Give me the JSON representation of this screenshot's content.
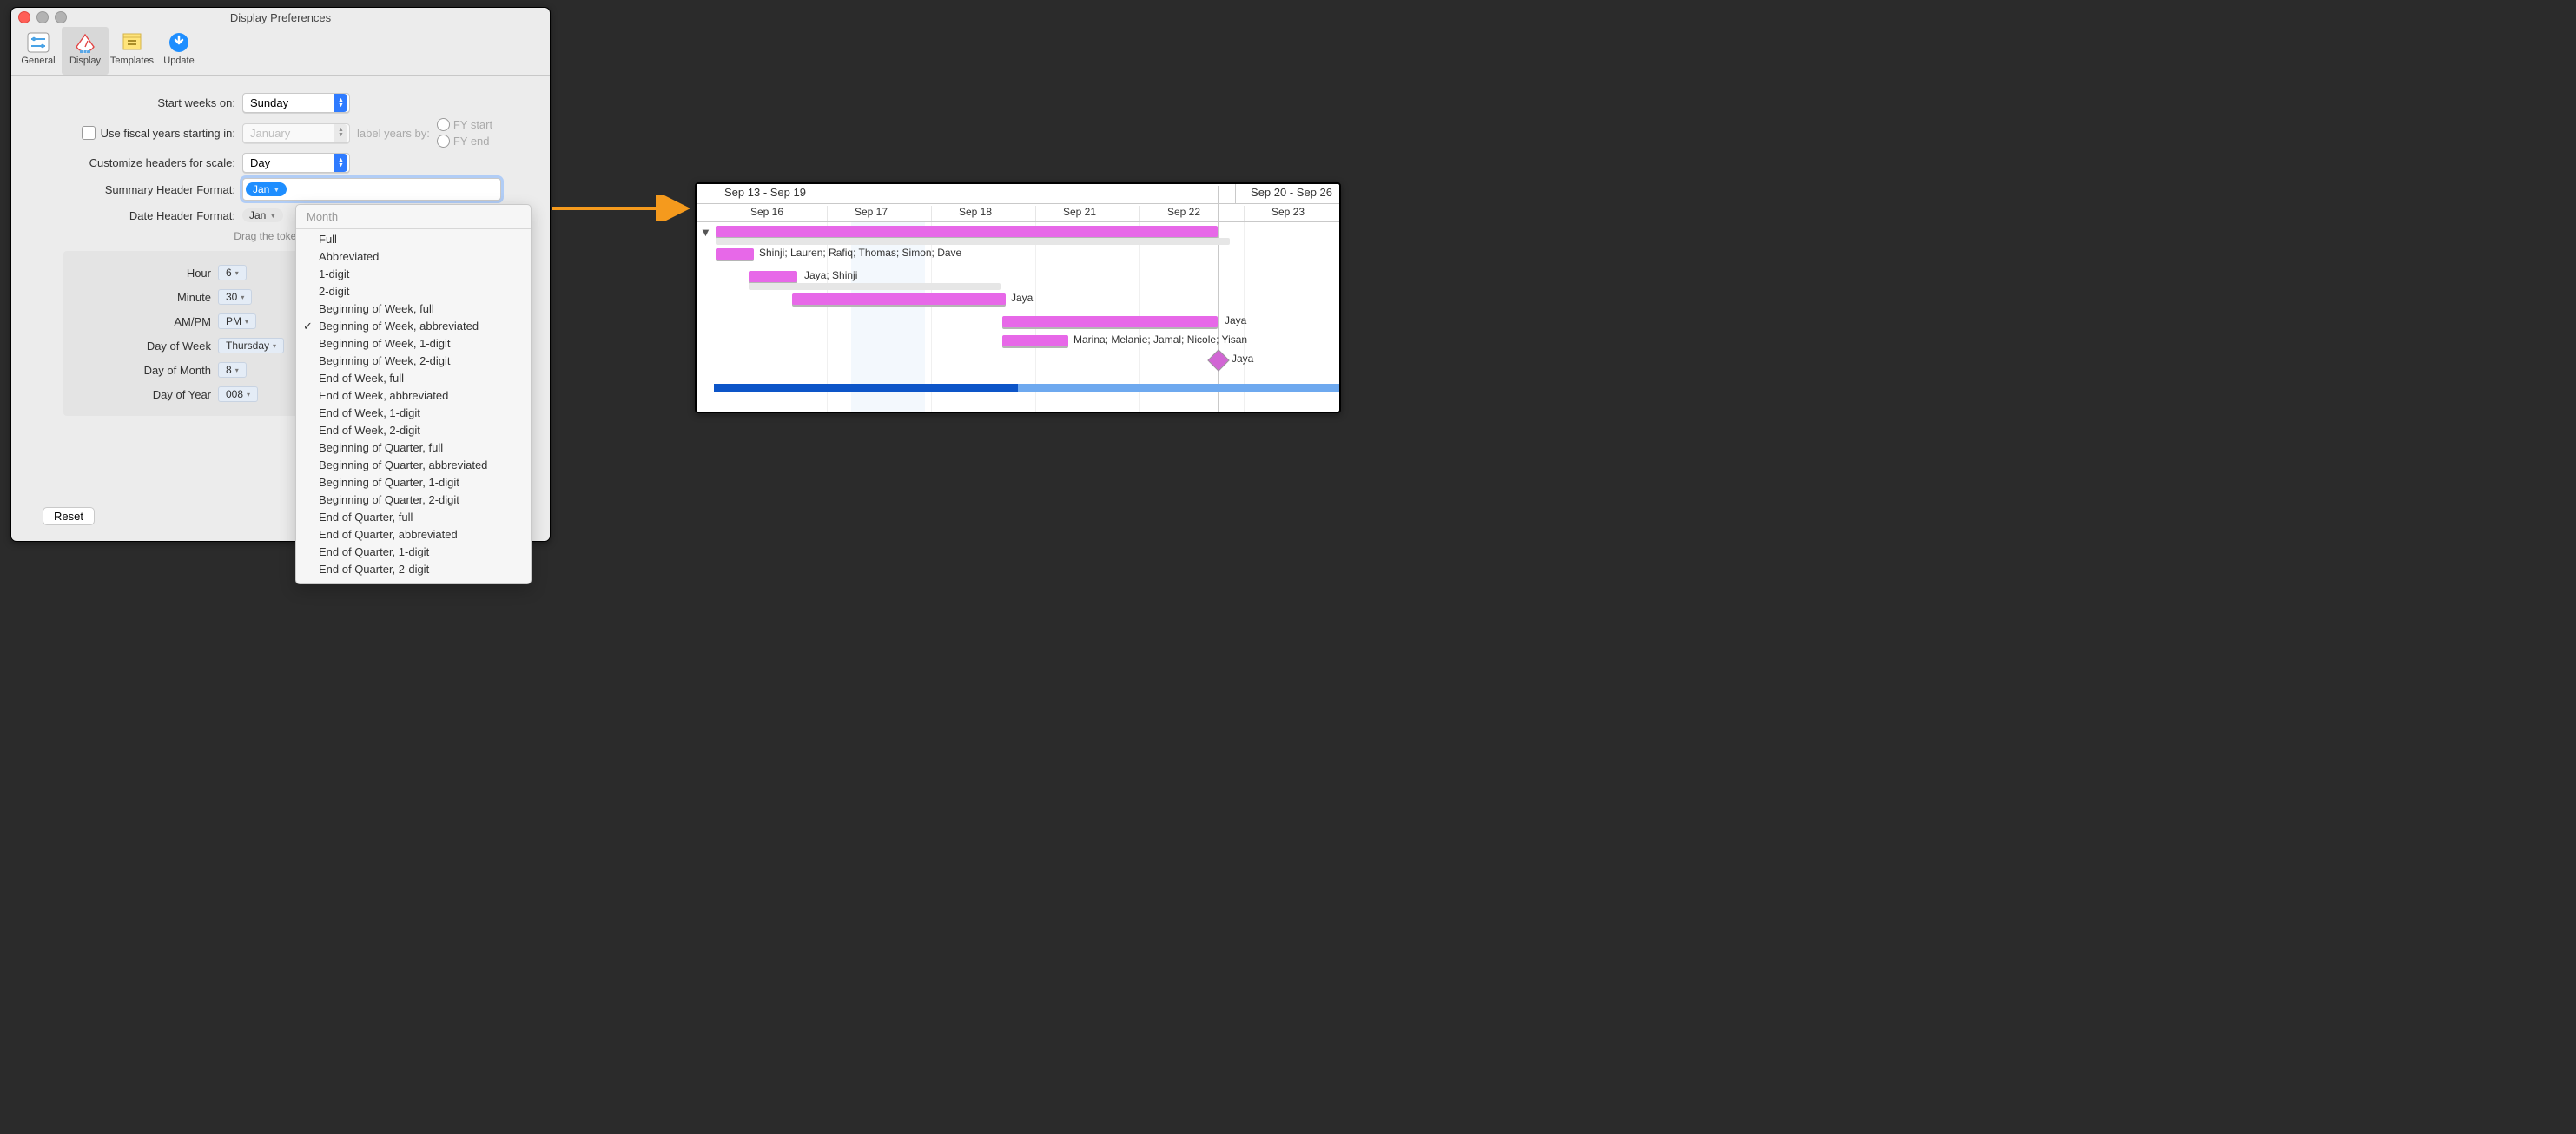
{
  "window": {
    "title": "Display Preferences",
    "toolbar": {
      "general": "General",
      "display": "Display",
      "templates": "Templates",
      "update": "Update",
      "selected": "display"
    },
    "form": {
      "start_weeks_label": "Start weeks on:",
      "start_weeks_value": "Sunday",
      "fiscal_checkbox_label": "Use fiscal years starting in:",
      "fiscal_month": "January",
      "label_years_by": "label years by:",
      "fy_start": "FY start",
      "fy_end": "FY end",
      "customize_label": "Customize headers for scale:",
      "customize_value": "Day",
      "summary_label": "Summary Header Format:",
      "summary_token": "Jan",
      "date_label": "Date Header Format:",
      "date_token": "Jan",
      "drag_hint": "Drag the tokens you",
      "hour_label": "Hour",
      "hour_value": "6",
      "minute_label": "Minute",
      "minute_value": "30",
      "ampm_label": "AM/PM",
      "ampm_value": "PM",
      "dow_label": "Day of Week",
      "dow_value": "Thursday",
      "dom_label": "Day of Month",
      "dom_value": "8",
      "doy_label": "Day of Year",
      "doy_value": "008",
      "reset": "Reset"
    }
  },
  "popup": {
    "title": "Month",
    "selected_index": 5,
    "items": [
      "Full",
      "Abbreviated",
      "1-digit",
      "2-digit",
      "Beginning of Week, full",
      "Beginning of Week, abbreviated",
      "Beginning of Week, 1-digit",
      "Beginning of Week, 2-digit",
      "End of Week, full",
      "End of Week, abbreviated",
      "End of Week, 1-digit",
      "End of Week, 2-digit",
      "Beginning of Quarter, full",
      "Beginning of Quarter, abbreviated",
      "Beginning of Quarter, 1-digit",
      "Beginning of Quarter, 2-digit",
      "End of Quarter, full",
      "End of Quarter, abbreviated",
      "End of Quarter, 1-digit",
      "End of Quarter, 2-digit"
    ]
  },
  "gantt": {
    "summary_headers": [
      "Sep 13 - Sep 19",
      "Sep 20 - Sep 26"
    ],
    "day_headers": [
      "Sep 16",
      "Sep 17",
      "Sep 18",
      "Sep 21",
      "Sep 22",
      "Sep 23"
    ],
    "tasks": [
      {
        "label": "Shinji; Lauren; Rafiq; Thomas; Simon; Dave"
      },
      {
        "label": "Jaya; Shinji"
      },
      {
        "label": "Jaya"
      },
      {
        "label": "Jaya"
      },
      {
        "label": "Marina; Melanie; Jamal; Nicole; Yisan"
      },
      {
        "label": "Jaya"
      }
    ]
  }
}
